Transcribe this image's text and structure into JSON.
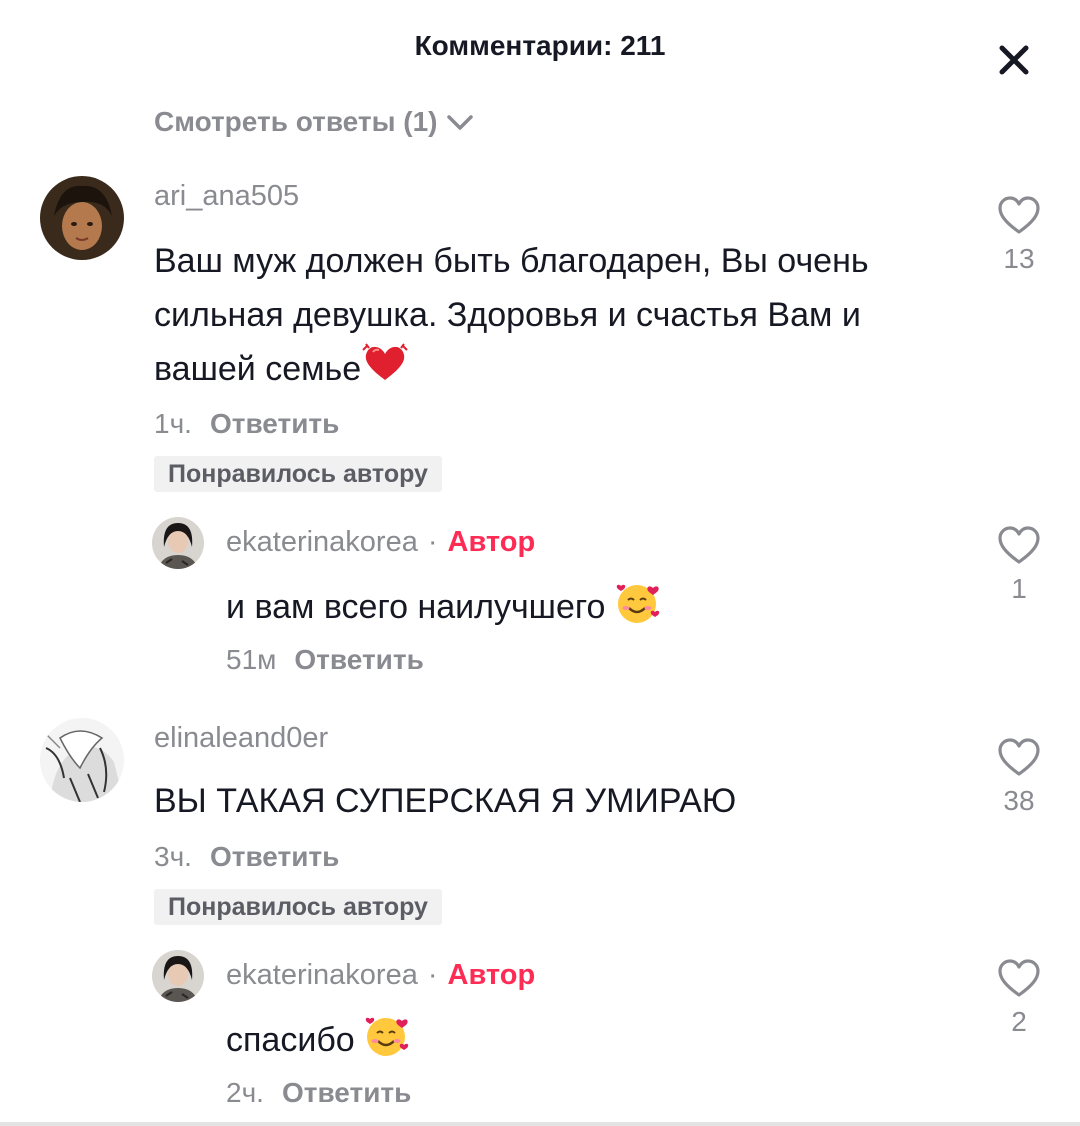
{
  "header": {
    "title": "Комментарии: 211",
    "close_icon": "close-icon"
  },
  "view_replies": {
    "label": "Смотреть ответы (1)",
    "icon": "chevron-down-icon"
  },
  "comments": [
    {
      "username": "ari_ana505",
      "text": "Ваш муж должен быть благодарен, Вы очень сильная девушка. Здоровья и счастья Вам и вашей семье",
      "emoji": "❤️",
      "time": "1ч.",
      "reply_label": "Ответить",
      "liked_by_author": "Понравилось автору",
      "likes": "13",
      "replies": [
        {
          "username": "ekaterinakorea",
          "separator": "·",
          "author_label": "Автор",
          "text": "и вам всего наилучшего",
          "emoji": "🥰",
          "time": "51м",
          "reply_label": "Ответить",
          "likes": "1"
        }
      ]
    },
    {
      "username": "elinaleand0er",
      "text": "ВЫ ТАКАЯ СУПЕРСКАЯ Я УМИРАЮ",
      "time": "3ч.",
      "reply_label": "Ответить",
      "liked_by_author": "Понравилось автору",
      "likes": "38",
      "replies": [
        {
          "username": "ekaterinakorea",
          "separator": "·",
          "author_label": "Автор",
          "text": "спасибо",
          "emoji": "🥰",
          "time": "2ч.",
          "reply_label": "Ответить",
          "likes": "2"
        }
      ]
    }
  ],
  "colors": {
    "text_primary": "#161823",
    "text_secondary": "#8a8b91",
    "author_accent": "#fe2c55",
    "badge_bg": "#f1f1f2"
  }
}
